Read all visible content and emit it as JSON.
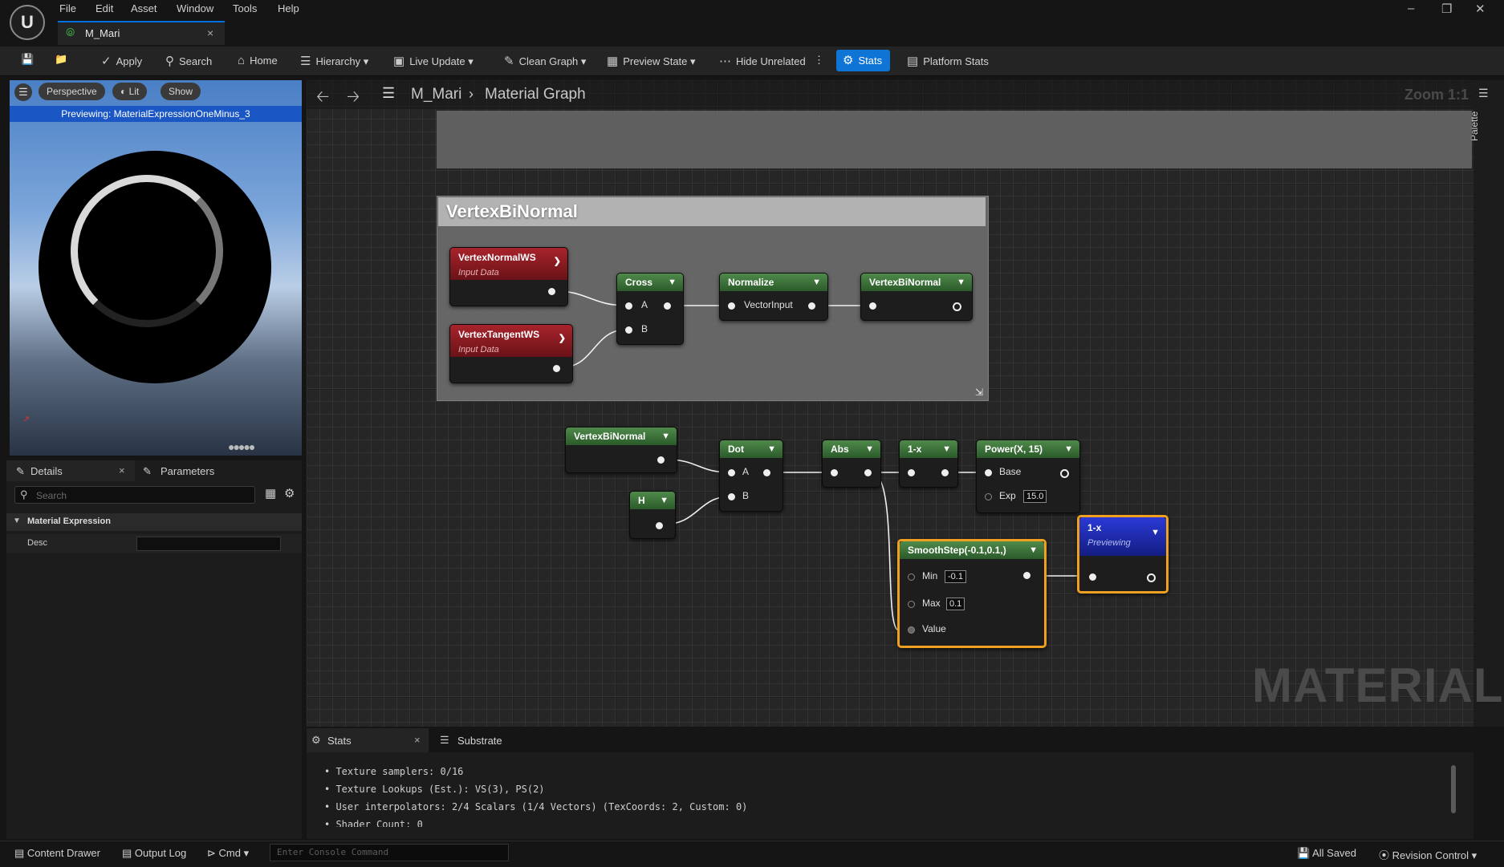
{
  "menu": [
    "File",
    "Edit",
    "Asset",
    "Window",
    "Tools",
    "Help"
  ],
  "window_controls": [
    "–",
    "❐",
    "✕"
  ],
  "doc_tab": {
    "title": "M_Mari",
    "close": "×"
  },
  "toolbar": {
    "apply": "Apply",
    "search": "Search",
    "home": "Home",
    "hierarchy": "Hierarchy",
    "live_update": "Live Update",
    "clean_graph": "Clean Graph",
    "preview_state": "Preview State",
    "hide_unrelated": "Hide Unrelated",
    "stats": "Stats",
    "platform_stats": "Platform Stats"
  },
  "viewport": {
    "perspective": "Perspective",
    "lit": "Lit",
    "show": "Show",
    "previewing": "Previewing: MaterialExpressionOneMinus_3"
  },
  "details": {
    "tab": "Details",
    "params_tab": "Parameters",
    "search_placeholder": "Search",
    "category": "Material Expression",
    "desc_label": "Desc"
  },
  "graph": {
    "breadcrumb_asset": "M_Mari",
    "breadcrumb_graph": "Material Graph",
    "zoom": "Zoom 1:1",
    "palette": "Palette",
    "comment": "VertexBiNormal",
    "watermark": "MATERIAL",
    "nodes": {
      "vertex_normal": {
        "title": "VertexNormalWS",
        "sub": "Input Data"
      },
      "vertex_tangent": {
        "title": "VertexTangentWS",
        "sub": "Input Data"
      },
      "cross": {
        "title": "Cross",
        "a": "A",
        "b": "B"
      },
      "normalize": {
        "title": "Normalize",
        "input": "VectorInput"
      },
      "vbn_out": {
        "title": "VertexBiNormal"
      },
      "vbn_in": {
        "title": "VertexBiNormal"
      },
      "h": {
        "title": "H"
      },
      "dot": {
        "title": "Dot",
        "a": "A",
        "b": "B"
      },
      "abs": {
        "title": "Abs"
      },
      "one_minus": {
        "title": "1-x"
      },
      "power": {
        "title": "Power(X, 15)",
        "base": "Base",
        "exp": "Exp",
        "exp_val": "15.0"
      },
      "smoothstep": {
        "title": "SmoothStep(-0.1,0.1,)",
        "min": "Min",
        "min_val": "-0.1",
        "max": "Max",
        "max_val": "0.1",
        "value": "Value"
      },
      "preview": {
        "title": "1-x",
        "sub": "Previewing"
      }
    }
  },
  "stats_panel": {
    "tab": "Stats",
    "substrate_tab": "Substrate",
    "lines": [
      "•  Texture samplers: 0/16",
      "•  Texture Lookups (Est.): VS(3), PS(2)",
      "•  User interpolators: 2/4 Scalars (1/4 Vectors) (TexCoords: 2, Custom: 0)",
      "•  Shader Count: 0"
    ]
  },
  "bottom": {
    "content_drawer": "Content Drawer",
    "output_log": "Output Log",
    "cmd": "Cmd",
    "console_placeholder": "Enter Console Command",
    "all_saved": "All Saved",
    "revision_control": "Revision Control"
  }
}
